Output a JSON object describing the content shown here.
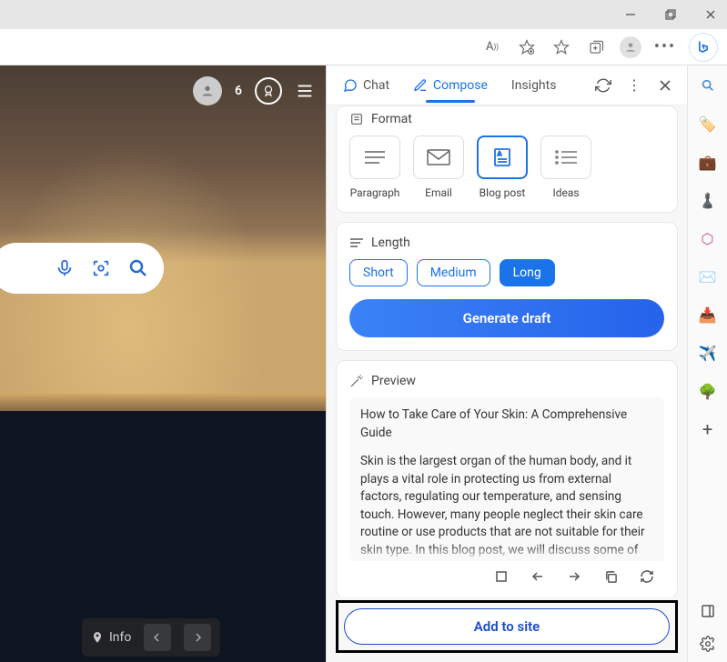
{
  "window": {
    "minimize": "–",
    "maximize": "❐",
    "close": "✕"
  },
  "browser_toolbar": {
    "read_aloud": "A⁺",
    "add_favorite": "⭐",
    "favorites": "☆",
    "collections": "⧉",
    "profile": "👤",
    "more": "⋯",
    "bing": "b"
  },
  "bing_page": {
    "rewards_count": "6",
    "search": {
      "mic": "mic",
      "lens": "lens",
      "mag": "search"
    },
    "info_label": "Info"
  },
  "sidepanel": {
    "tabs": {
      "chat": "Chat",
      "compose": "Compose",
      "insights": "Insights"
    },
    "format": {
      "title": "Format",
      "items": {
        "paragraph": "Paragraph",
        "email": "Email",
        "blogpost": "Blog post",
        "ideas": "Ideas"
      }
    },
    "length": {
      "title": "Length",
      "options": {
        "short": "Short",
        "medium": "Medium",
        "long": "Long"
      }
    },
    "generate": "Generate draft",
    "preview": {
      "title": "Preview",
      "body_title": "How to Take Care of Your Skin: A Comprehensive Guide",
      "body_text": "Skin is the largest organ of the human body, and it plays a vital role in protecting us from external factors, regulating our temperature, and sensing touch. However, many people neglect their skin care routine or use products that are not suitable for their skin type. In this blog post, we will discuss some of the basics of"
    },
    "add_to_site": "Add to site"
  }
}
